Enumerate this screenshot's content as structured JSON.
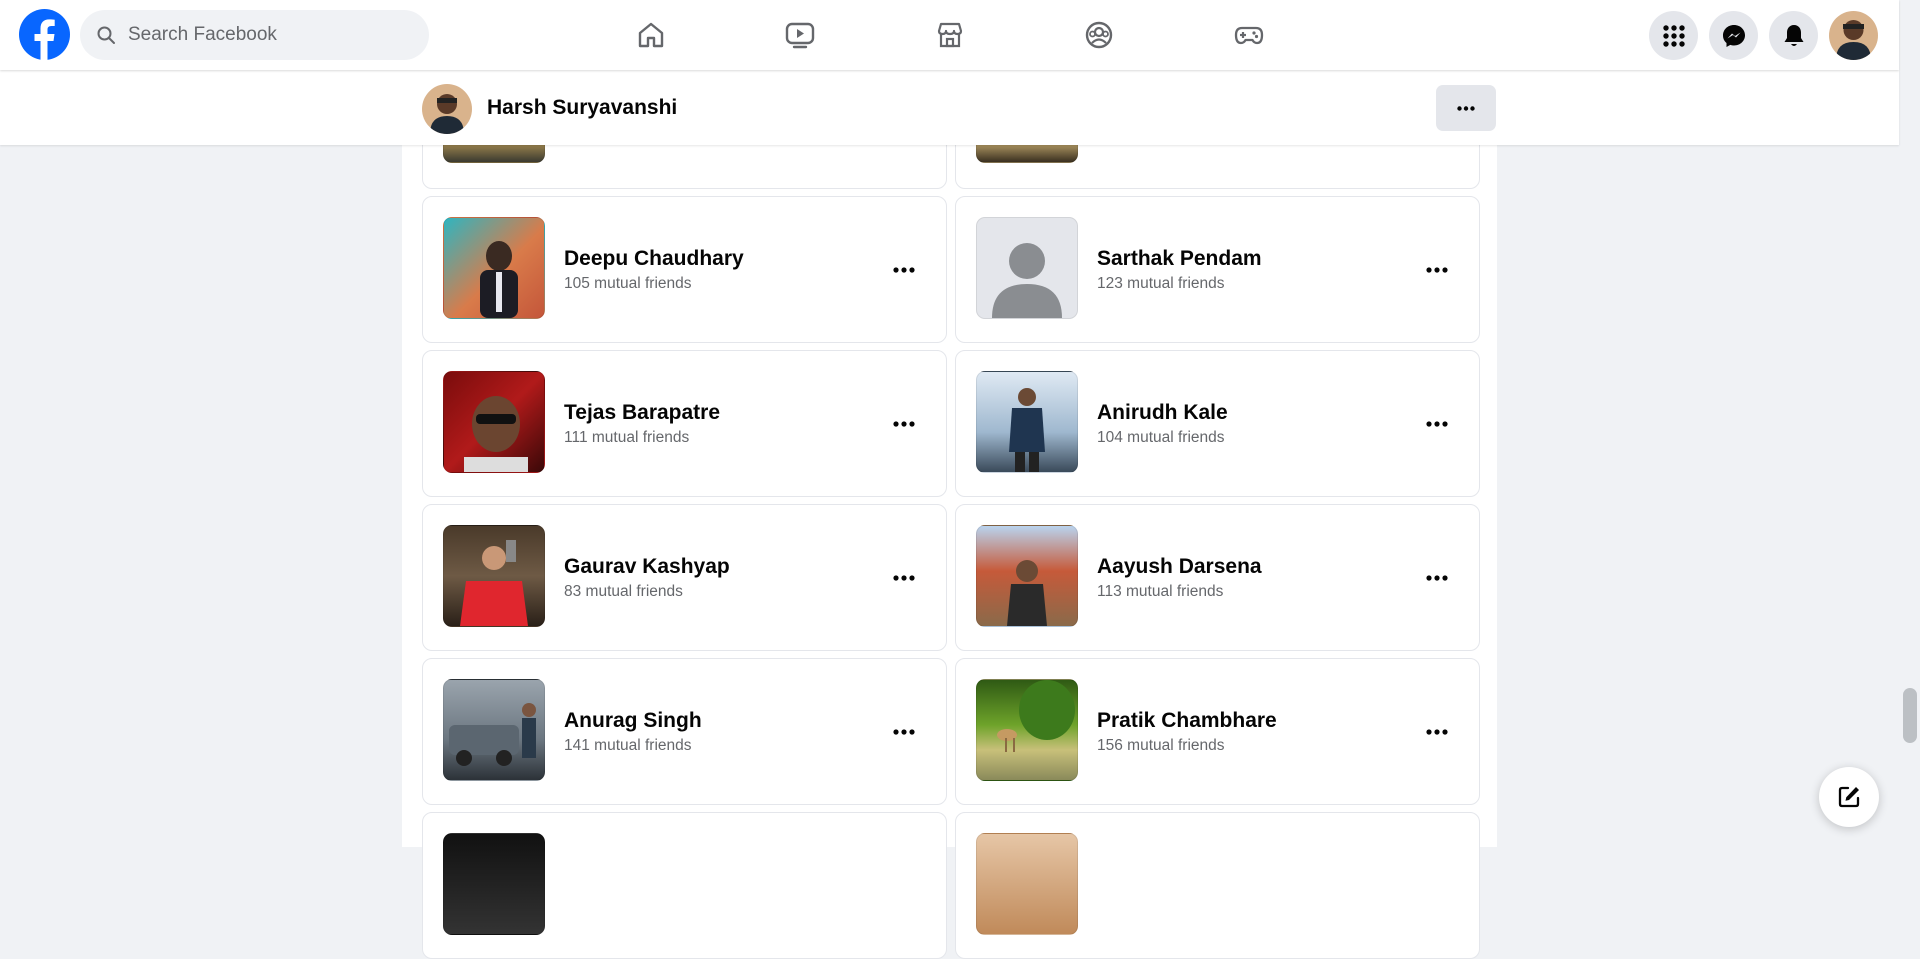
{
  "search": {
    "placeholder": "Search Facebook"
  },
  "nav": {
    "icons": [
      "home-icon",
      "video-icon",
      "marketplace-icon",
      "groups-icon",
      "gaming-icon"
    ],
    "right": [
      "menu-grid-icon",
      "messenger-icon",
      "notifications-icon"
    ]
  },
  "profile": {
    "name": "Harsh Suryavanshi",
    "more_label": "•••"
  },
  "friends": [
    {
      "name": "Deepu Chaudhary",
      "mutual": "105 mutual friends"
    },
    {
      "name": "Sarthak Pendam",
      "mutual": "123 mutual friends"
    },
    {
      "name": "Tejas Barapatre",
      "mutual": "111 mutual friends"
    },
    {
      "name": "Anirudh Kale",
      "mutual": "104 mutual friends"
    },
    {
      "name": "Gaurav Kashyap",
      "mutual": "83 mutual friends"
    },
    {
      "name": "Aayush Darsena",
      "mutual": "113 mutual friends"
    },
    {
      "name": "Anurag Singh",
      "mutual": "141 mutual friends"
    },
    {
      "name": "Pratik Chambhare",
      "mutual": "156 mutual friends"
    }
  ],
  "colors": {
    "brand": "#0866ff",
    "secondary_text": "#65676b",
    "page_bg": "#f0f2f5"
  }
}
